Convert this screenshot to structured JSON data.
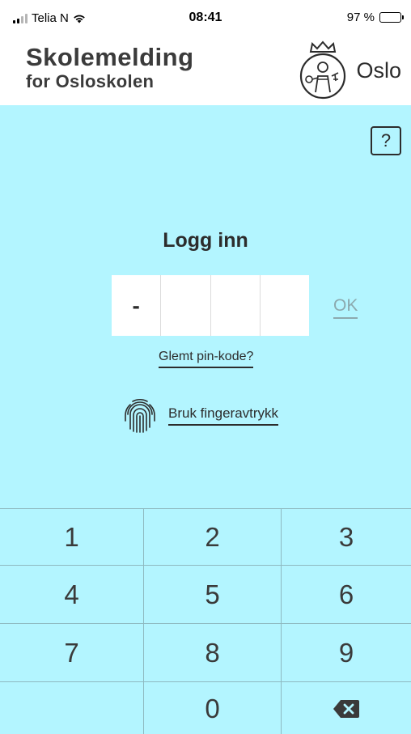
{
  "status_bar": {
    "carrier": "Telia N",
    "time": "08:41",
    "battery": "97 %",
    "battery_level": 0.97
  },
  "header": {
    "title": "Skolemelding",
    "subtitle": "for Osloskolen",
    "city": "Oslo",
    "logo_icon": "oslo-city-seal-icon"
  },
  "help": {
    "label": "?"
  },
  "login": {
    "title": "Logg inn",
    "pin_digits": [
      "-",
      "",
      "",
      ""
    ],
    "ok_label": "OK",
    "forgot_label": "Glemt pin-kode?",
    "fingerprint_label": "Bruk fingeravtrykk",
    "fingerprint_icon": "fingerprint-icon"
  },
  "keypad": {
    "keys": [
      "1",
      "2",
      "3",
      "4",
      "5",
      "6",
      "7",
      "8",
      "9",
      "",
      "0",
      "backspace"
    ]
  },
  "colors": {
    "background": "#b3f5ff",
    "text": "#2c2c2c",
    "divider": "#8eb9c0",
    "ok_disabled": "#8ca9ae"
  }
}
